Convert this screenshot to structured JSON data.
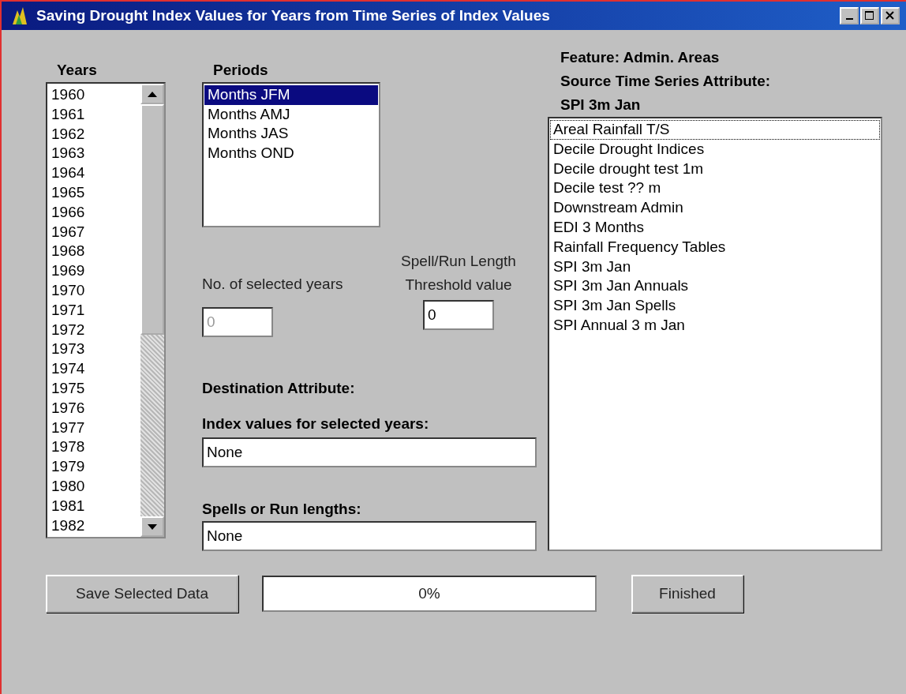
{
  "window": {
    "title": "Saving Drought Index Values for Years from Time Series of Index Values"
  },
  "years": {
    "label": "Years",
    "items": [
      {
        "label": "1960",
        "selected": false
      },
      {
        "label": "1961",
        "selected": false
      },
      {
        "label": "1962",
        "selected": false
      },
      {
        "label": "1963",
        "selected": false
      },
      {
        "label": "1964",
        "selected": false
      },
      {
        "label": "1965",
        "selected": false
      },
      {
        "label": "1966",
        "selected": false
      },
      {
        "label": "1967",
        "selected": false
      },
      {
        "label": "1968",
        "selected": false
      },
      {
        "label": "1969",
        "selected": false
      },
      {
        "label": "1970",
        "selected": false
      },
      {
        "label": "1971",
        "selected": false
      },
      {
        "label": "1972",
        "selected": false
      },
      {
        "label": "1973",
        "selected": false
      },
      {
        "label": "1974",
        "selected": false
      },
      {
        "label": "1975",
        "selected": false
      },
      {
        "label": "1976",
        "selected": false
      },
      {
        "label": "1977",
        "selected": false
      },
      {
        "label": "1978",
        "selected": false
      },
      {
        "label": "1979",
        "selected": false
      },
      {
        "label": "1980",
        "selected": false
      },
      {
        "label": "1981",
        "selected": false
      },
      {
        "label": "1982",
        "selected": false
      }
    ]
  },
  "periods": {
    "label": "Periods",
    "items": [
      {
        "label": "Months JFM",
        "selected": true
      },
      {
        "label": "Months AMJ",
        "selected": false
      },
      {
        "label": "Months JAS",
        "selected": false
      },
      {
        "label": "Months OND",
        "selected": false
      }
    ]
  },
  "selected_years": {
    "label": "No. of selected years",
    "value": "0",
    "disabled": true
  },
  "threshold": {
    "label": "Spell/Run Length\nThreshold value",
    "value": "0",
    "disabled": false
  },
  "destination": {
    "heading": "Destination Attribute:",
    "index_values": {
      "label": "Index values for selected years:",
      "value": "None"
    },
    "spells": {
      "label": "Spells or Run lengths:",
      "value": "None"
    }
  },
  "source": {
    "feature": "Feature: Admin. Areas",
    "heading": "Source Time Series Attribute:",
    "attribute": "SPI 3m Jan",
    "items": [
      {
        "label": "Areal Rainfall T/S",
        "selected": false,
        "focused": true
      },
      {
        "label": "Decile Drought Indices",
        "selected": false,
        "focused": false
      },
      {
        "label": "Decile drought test 1m",
        "selected": false,
        "focused": false
      },
      {
        "label": "Decile test ?? m",
        "selected": false,
        "focused": false
      },
      {
        "label": "Downstream Admin",
        "selected": false,
        "focused": false
      },
      {
        "label": "EDI 3 Months",
        "selected": false,
        "focused": false
      },
      {
        "label": "Rainfall Frequency Tables",
        "selected": false,
        "focused": false
      },
      {
        "label": "SPI 3m Jan",
        "selected": false,
        "focused": false
      },
      {
        "label": "SPI 3m Jan Annuals",
        "selected": false,
        "focused": false
      },
      {
        "label": "SPI 3m Jan Spells",
        "selected": false,
        "focused": false
      },
      {
        "label": "SPI Annual 3 m Jan",
        "selected": false,
        "focused": false
      }
    ]
  },
  "save_button": "Save Selected Data",
  "progress": {
    "level": 0,
    "text": "0%"
  },
  "finish_button": "Finished"
}
